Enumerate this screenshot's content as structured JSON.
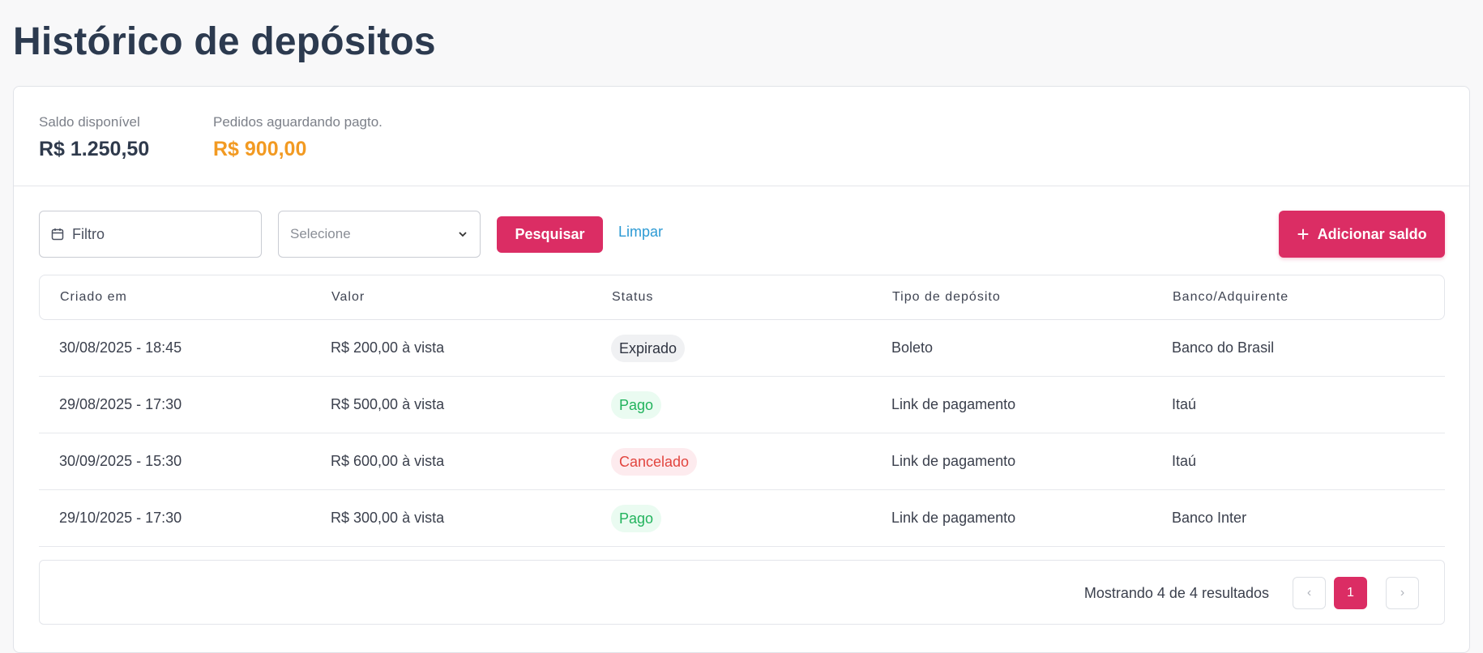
{
  "page": {
    "title": "Histórico de depósitos"
  },
  "summary": {
    "balance_label": "Saldo disponível",
    "balance_value": "R$ 1.250,50",
    "pending_label": "Pedidos aguardando pagto.",
    "pending_value": "R$ 900,00"
  },
  "toolbar": {
    "date_filter_placeholder": "Filtro",
    "select_placeholder": "Selecione",
    "search_label": "Pesquisar",
    "clear_label": "Limpar",
    "add_label": "Adicionar saldo"
  },
  "table": {
    "headers": [
      "Criado em",
      "Valor",
      "Status",
      "Tipo de depósito",
      "Banco/Adquirente"
    ],
    "rows": [
      {
        "created": "30/08/2025 - 18:45",
        "value": "R$ 200,00 à vista",
        "status": "Expirado",
        "type": "Boleto",
        "bank": "Banco do Brasil"
      },
      {
        "created": "29/08/2025 - 17:30",
        "value": "R$ 500,00 à vista",
        "status": "Pago",
        "type": "Link de pagamento",
        "bank": "Itaú"
      },
      {
        "created": "30/09/2025 - 15:30",
        "value": "R$ 600,00 à vista",
        "status": "Cancelado",
        "type": "Link de pagamento",
        "bank": "Itaú"
      },
      {
        "created": "29/10/2025 - 17:30",
        "value": "R$ 300,00 à vista",
        "status": "Pago",
        "type": "Link de pagamento",
        "bank": "Banco Inter"
      }
    ]
  },
  "pagination": {
    "summary": "Mostrando 4 de 4 resultados",
    "current_page": "1",
    "prev_icon": "‹",
    "next_icon": "›"
  },
  "colors": {
    "primary": "#db2d64",
    "pending": "#f29a22",
    "link": "#2c9ad4"
  },
  "icons": [
    "calendar-icon",
    "chevron-down-icon",
    "plus-icon",
    "chevron-left-icon",
    "chevron-right-icon"
  ]
}
